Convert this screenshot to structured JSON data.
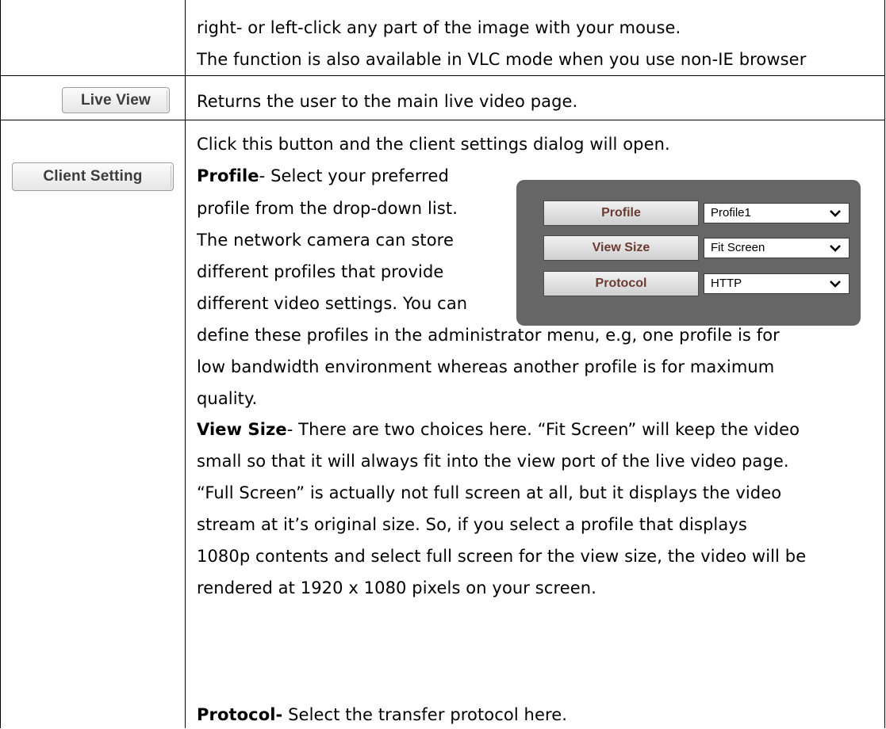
{
  "row1": {
    "line1": "right- or left-click any part of the image with your mouse.",
    "line2": "The function is also available in VLC mode when you use non-IE browser"
  },
  "row2": {
    "button_label": "Live View",
    "description": "Returns the user to the main live video page."
  },
  "row3": {
    "button_label": "Client Setting",
    "intro": "Click this button and the client settings dialog will open.",
    "profile_heading": "Profile",
    "profile_lines": [
      "- Select your preferred",
      "profile from the drop-down list.",
      "The network camera can store",
      "different profiles that provide",
      "different video settings. You can",
      "define these profiles in the administrator menu, e.g, one profile is for",
      "low bandwidth environment whereas another profile is for maximum",
      "quality."
    ],
    "view_size_heading": "View Size",
    "view_size_lines": [
      "- There are two choices here. “Fit Screen” will keep the video",
      "small so that it will always fit into the view port of the live video page.",
      "“Full Screen” is actually not full screen at all, but it displays the video",
      "stream at it’s   original size. So, if you select a profile that displays",
      "1080p contents and select full screen for the view size, the video will be",
      "rendered at 1920 x 1080 pixels on your screen."
    ],
    "protocol_heading": "Protocol-",
    "protocol_text": " Select the transfer protocol here."
  },
  "settings_panel": {
    "rows": [
      {
        "label": "Profile",
        "value": "Profile1"
      },
      {
        "label": "View Size",
        "value": "Fit Screen"
      },
      {
        "label": "Protocol",
        "value": "HTTP"
      }
    ],
    "dropdown_icon": "chevron-down-icon"
  }
}
